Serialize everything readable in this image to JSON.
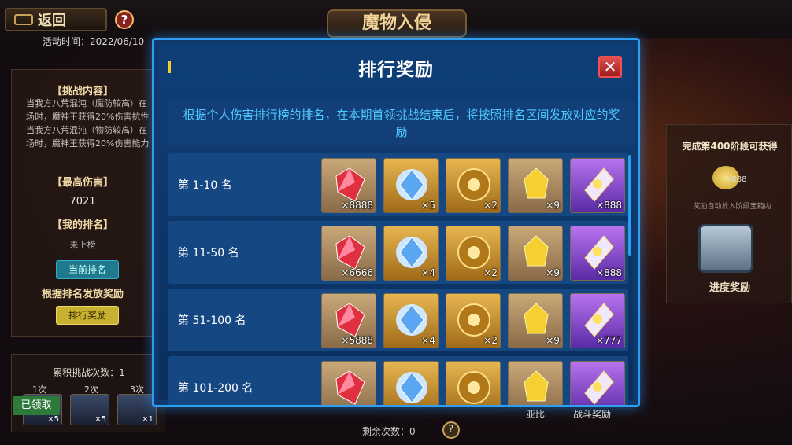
{
  "background": {
    "back_label": "返回",
    "help_symbol": "?",
    "activity_time": "活动时间：2022/06/10-",
    "event_title": "魔物入侵",
    "left_panel": {
      "challenge_title": "【挑战内容】",
      "challenge_text": "当我方八荒混沌（魔防较高）在场时，魔神王获得20%伤害抗性 当我方八荒混沌（物防较高）在场时，魔神王获得20%伤害能力提升",
      "max_damage_title": "【最高伤害】",
      "max_damage_value": "7021",
      "my_rank_title": "【我的排名】",
      "my_rank_value": "未上榜",
      "current_rank_button": "当前排名",
      "reward_by_rank_text": "根据排名发放奖励",
      "rank_reward_button": "排行奖励"
    },
    "left_bottom": {
      "title": "累积挑战次数：1",
      "slots": [
        {
          "label": "1次",
          "qty": "×5"
        },
        {
          "label": "2次",
          "qty": "×5"
        },
        {
          "label": "3次",
          "qty": "×1"
        }
      ],
      "claimed_label": "已领取"
    },
    "right_panel": {
      "title": "完成第400阶段可获得",
      "coin_qty": "×888",
      "note": "奖励自动放入阶段宝箱内",
      "label": "进度奖励"
    },
    "remaining": "剩余次数：0",
    "under_label_1": "亚比",
    "under_label_2": "战斗奖励"
  },
  "modal": {
    "title": "排行奖励",
    "close_symbol": "✕",
    "description": "根据个人伤害排行榜的排名，在本期首领挑战结束后，将按照排名区间发放对应的奖励",
    "rows": [
      {
        "rank": "第 1-10 名",
        "items": [
          "×8888",
          "×5",
          "×2",
          "×9",
          "×888"
        ]
      },
      {
        "rank": "第 11-50 名",
        "items": [
          "×6666",
          "×4",
          "×2",
          "×9",
          "×888"
        ]
      },
      {
        "rank": "第 51-100 名",
        "items": [
          "×5888",
          "×4",
          "×2",
          "×9",
          "×777"
        ]
      },
      {
        "rank": "第 101-200 名",
        "items": [
          "",
          "",
          "",
          "",
          ""
        ]
      }
    ],
    "item_icons": [
      "red-crystal-icon",
      "blue-gem-icon",
      "golden-orb-icon",
      "gold-crystal-icon",
      "purple-shard-icon"
    ]
  }
}
